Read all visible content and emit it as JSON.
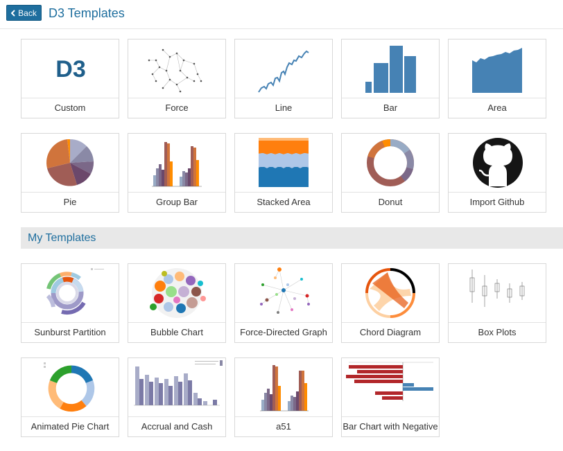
{
  "header": {
    "back_label": "Back",
    "title": "D3 Templates"
  },
  "templates": [
    {
      "label": "Custom",
      "icon": "d3-logo-icon",
      "logo_text": "D3"
    },
    {
      "label": "Force",
      "icon": "force-graph-thumbnail"
    },
    {
      "label": "Line",
      "icon": "line-chart-thumbnail"
    },
    {
      "label": "Bar",
      "icon": "bar-chart-thumbnail"
    },
    {
      "label": "Area",
      "icon": "area-chart-thumbnail"
    },
    {
      "label": "Pie",
      "icon": "pie-chart-thumbnail"
    },
    {
      "label": "Group Bar",
      "icon": "group-bar-thumbnail"
    },
    {
      "label": "Stacked Area",
      "icon": "stacked-area-thumbnail"
    },
    {
      "label": "Donut",
      "icon": "donut-chart-thumbnail"
    },
    {
      "label": "Import Github",
      "icon": "github-icon"
    }
  ],
  "my_templates_section": {
    "title": "My Templates"
  },
  "my_templates": [
    {
      "label": "Sunburst Partition",
      "icon": "sunburst-thumbnail"
    },
    {
      "label": "Bubble Chart",
      "icon": "bubble-chart-thumbnail"
    },
    {
      "label": "Force-Directed Graph",
      "icon": "force-directed-thumbnail"
    },
    {
      "label": "Chord Diagram",
      "icon": "chord-diagram-thumbnail"
    },
    {
      "label": "Box Plots",
      "icon": "box-plot-thumbnail"
    },
    {
      "label": "Animated Pie Chart",
      "icon": "animated-pie-thumbnail"
    },
    {
      "label": "Accrual and Cash",
      "icon": "accrual-cash-thumbnail"
    },
    {
      "label": "a51",
      "icon": "a51-thumbnail"
    },
    {
      "label": "Bar Chart with Negative",
      "icon": "negative-bar-thumbnail"
    }
  ],
  "colors": {
    "accent": "#1e6e9e",
    "steel_blue": "#4682b4",
    "section_bg": "#e8e8e8"
  }
}
